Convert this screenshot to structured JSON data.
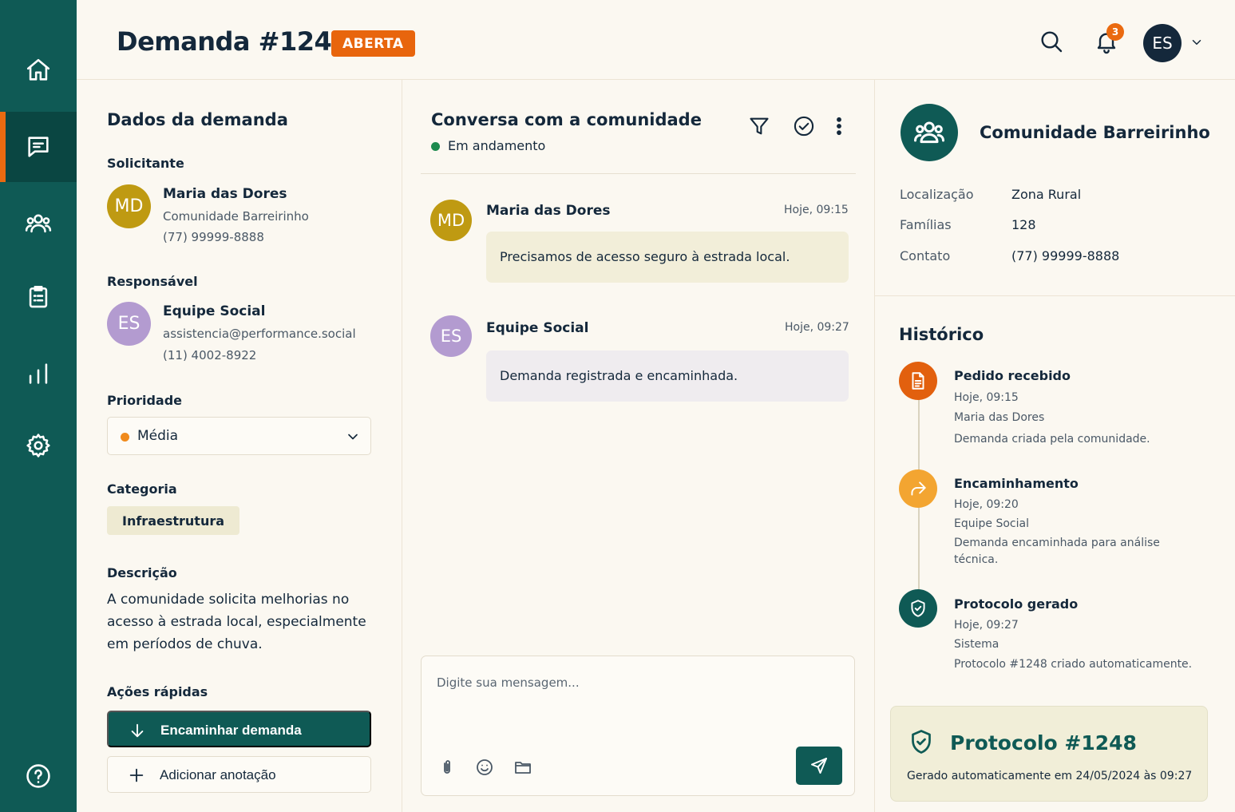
{
  "header": {
    "title": "Demanda #1248",
    "status": "ABERTA",
    "notification_count": "3",
    "user_initials": "ES"
  },
  "sidebar": {
    "items": [
      {
        "name": "home",
        "icon": "home-icon"
      },
      {
        "name": "messages",
        "icon": "chat-icon",
        "active": true
      },
      {
        "name": "communities",
        "icon": "users-icon"
      },
      {
        "name": "tasks",
        "icon": "clipboard-icon"
      },
      {
        "name": "reports",
        "icon": "bar-chart-icon"
      },
      {
        "name": "settings",
        "icon": "gear-icon"
      },
      {
        "name": "help",
        "icon": "help-icon"
      }
    ]
  },
  "details": {
    "title": "Dados da demanda",
    "requester_label": "Solicitante",
    "requester": {
      "initials": "MD",
      "name": "Maria das Dores",
      "org": "Comunidade Barreirinho",
      "phone": "(77) 99999-8888"
    },
    "responsible_label": "Responsável",
    "responsible": {
      "initials": "ES",
      "name": "Equipe Social",
      "email": "assistencia@performance.social",
      "phone": "(11) 4002-8922"
    },
    "priority_label": "Prioridade",
    "priority_value": "Média",
    "category_label": "Categoria",
    "category_value": "Infraestrutura",
    "description_label": "Descrição",
    "description": "A comunidade solicita melhorias no acesso à estrada local, especialmente em períodos de chuva.",
    "quick_actions_label": "Ações rápidas",
    "forward_button": "Encaminhar demanda",
    "add_note_button": "Adicionar anotação"
  },
  "chat": {
    "title": "Conversa com a comunidade",
    "status": "Em andamento",
    "messages": [
      {
        "initials": "MD",
        "name": "Maria das Dores",
        "time": "Hoje, 09:15",
        "text": "Precisamos de acesso seguro à estrada local."
      },
      {
        "initials": "ES",
        "name": "Equipe Social",
        "time": "Hoje, 09:27",
        "text": "Demanda registrada e encaminhada."
      }
    ],
    "placeholder": "Digite sua mensagem..."
  },
  "community": {
    "name": "Comunidade Barreirinho",
    "location_label": "Localização",
    "location": "Zona Rural",
    "families_label": "Famílias",
    "families": "128",
    "contact_label": "Contato",
    "contact": "(77) 99999-8888"
  },
  "history": {
    "title": "Histórico",
    "events": [
      {
        "title": "Pedido recebido",
        "time": "Hoje, 09:15",
        "actor": "Maria das Dores",
        "desc": "Demanda criada pela comunidade."
      },
      {
        "title": "Encaminhamento",
        "time": "Hoje, 09:20",
        "actor": "Equipe Social",
        "desc": "Demanda encaminhada para análise técnica."
      },
      {
        "title": "Protocolo gerado",
        "time": "Hoje, 09:27",
        "actor": "Sistema",
        "desc": "Protocolo #1248 criado automaticamente."
      }
    ]
  },
  "protocol": {
    "title": "Protocolo #1248",
    "subtitle": "Gerado automaticamente em 24/05/2024 às 09:27"
  },
  "colors": {
    "sidebar": "#0f5a55",
    "accent": "#e8650d",
    "navy": "#14283b",
    "avatar_md": "#bf9a12",
    "avatar_es": "#b39bd0",
    "bubble_md": "#f2eed9",
    "bubble_es": "#efecef",
    "tl_received": "#e2600e",
    "tl_forward": "#f3a531",
    "tl_protocol": "#0f5a55"
  }
}
